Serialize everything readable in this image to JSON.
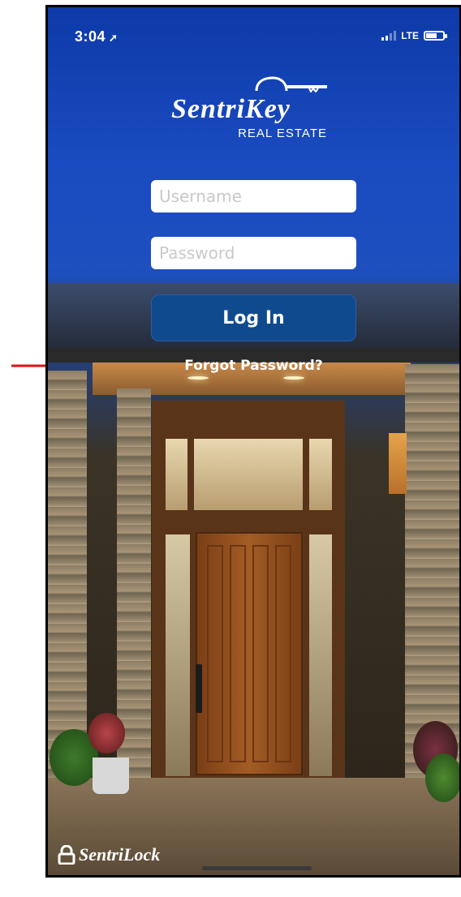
{
  "status_bar": {
    "time": "3:04",
    "network": "LTE"
  },
  "logo": {
    "brand": "SentriKey",
    "subtitle": "REAL ESTATE"
  },
  "login_form": {
    "username_placeholder": "Username",
    "password_placeholder": "Password",
    "login_label": "Log In",
    "forgot_label": "Forgot Password?"
  },
  "footer": {
    "brand": "SentriLock"
  },
  "colors": {
    "sky_top": "#0d3aa8",
    "button_bg": "#0f4a8f",
    "annotation_arrow": "#e01010"
  },
  "icons": [
    "location-arrow-icon",
    "signal-bars-icon",
    "battery-icon",
    "key-logo-icon",
    "lock-icon",
    "annotation-arrow"
  ]
}
